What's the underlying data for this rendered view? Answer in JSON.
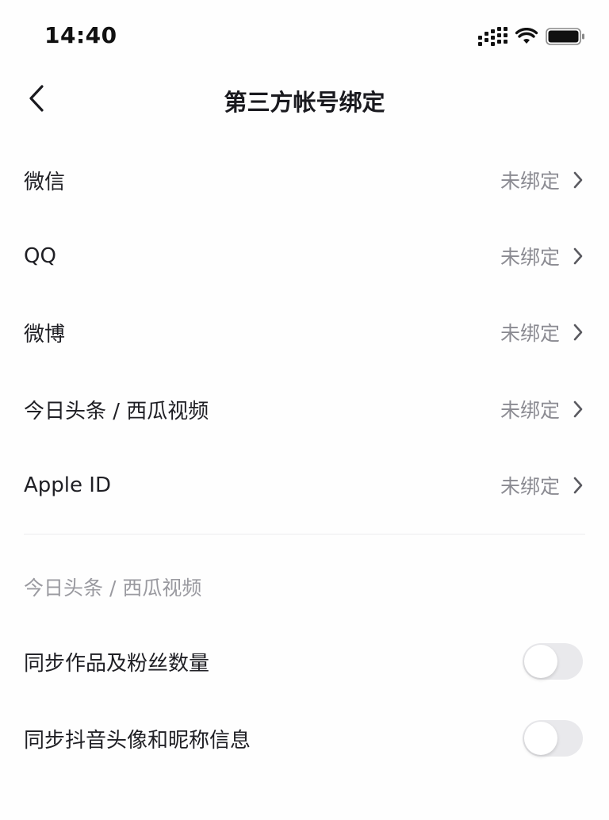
{
  "status_bar": {
    "time": "14:40"
  },
  "nav": {
    "title": "第三方帐号绑定"
  },
  "accounts": [
    {
      "label": "微信",
      "status": "未绑定"
    },
    {
      "label": "QQ",
      "status": "未绑定"
    },
    {
      "label": "微博",
      "status": "未绑定"
    },
    {
      "label": "今日头条 / 西瓜视频",
      "status": "未绑定"
    },
    {
      "label": "Apple ID",
      "status": "未绑定"
    }
  ],
  "sync_section": {
    "header": "今日头条 / 西瓜视频",
    "toggles": [
      {
        "label": "同步作品及粉丝数量",
        "on": false
      },
      {
        "label": "同步抖音头像和昵称信息",
        "on": false
      }
    ]
  },
  "colors": {
    "background": "#fefefe",
    "primary_text": "#1f1f24",
    "secondary_text": "#8b8b92",
    "toggle_off": "#e9e9ec"
  }
}
